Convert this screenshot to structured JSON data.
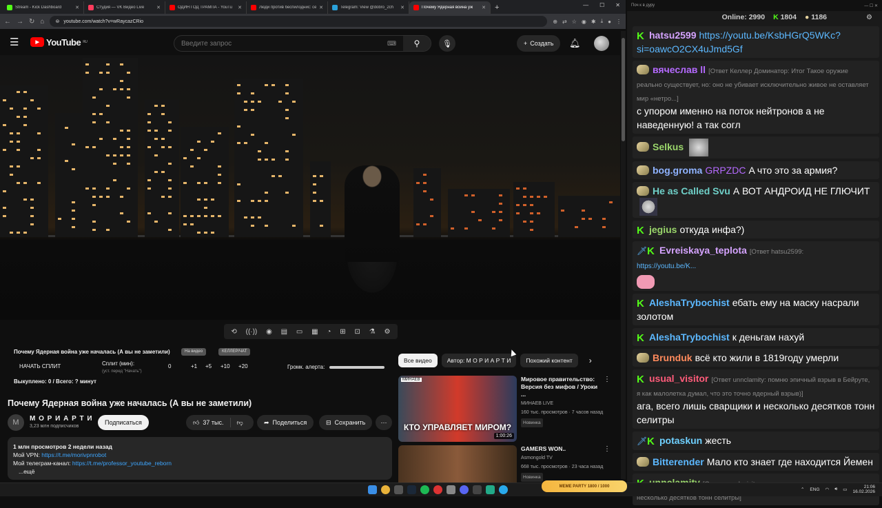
{
  "browser": {
    "tabs": [
      {
        "title": "Stream - Kick Dashboard",
        "color": "#53fc18"
      },
      {
        "title": "Студия — VK Видео Live",
        "color": "#ff3b5c"
      },
      {
        "title": "ОДИН ГОД ТРАМПА - YouTu",
        "color": "#ff0000"
      },
      {
        "title": "Люди против беспилоднис: сем",
        "color": "#ff0000"
      },
      {
        "title": "Telegram: View @dobro_2ch",
        "color": "#2aa1da"
      },
      {
        "title": "Почему Ядерная война уж",
        "color": "#ff0000"
      }
    ],
    "url": "youtube.com/watch?v=wRaycazCRio"
  },
  "youtube": {
    "logo_text": "YouTube",
    "logo_region": "RU",
    "search_placeholder": "Введите запрос",
    "create_label": "Создать",
    "video_overlay": {
      "title": "Почему Ядерная война уже началась (А вы не заметили)",
      "badge1": "На видео",
      "badge2": "КЕЛЛЕР/ЧАТ",
      "split_start": "НАЧАТЬ СПЛИТ",
      "split_label": "Сплит (мин):",
      "split_sub": "(уст. перед \"Начать\")",
      "split_values": [
        "0",
        "+1",
        "+5",
        "+10",
        "+20"
      ],
      "alert_label": "Громк. алерта:",
      "bought": "Выкуплено: 0 / Всего: ? минут"
    },
    "title": "Почему Ядерная война уже началась (А вы не заметили)",
    "channel": {
      "name": "М О Р И А Р Т И",
      "subs": "3,23 млн подписчиков",
      "subscribe": "Подписаться"
    },
    "likes": "37 тыс.",
    "share": "Поделиться",
    "save": "Сохранить",
    "description": {
      "meta": "1 млн просмотров  2 недели назад",
      "vpn_label": "Мой VPN: ",
      "vpn_link": "https://t.me/morivpnrobot",
      "tg_label": "Мой телеграм-канал: ",
      "tg_link": "https://t.me/professor_youtube_reborn",
      "more": "...ещё"
    },
    "chips": [
      "Все видео",
      "Автор: М О Р И А Р Т И",
      "Похожий контент"
    ],
    "recommendations": [
      {
        "title": "Мировое правительство: Версия без мифов / Уроки ...",
        "channel": "МИНАЕВ LIVE",
        "meta": "160 тыс. просмотров · 7 часов назад",
        "badge": "Новинка",
        "duration": "1:00:26",
        "thumb_caption": "КТО УПРАВЛЯЕТ МИРОМ?",
        "thumb_label": "МИНАЕВ"
      },
      {
        "title": "GAMERS WON..",
        "channel": "Asmongold TV",
        "meta": "668 тыс. просмотров · 23 часа назад",
        "badge": "Новинка",
        "duration": "",
        "thumb_caption": "",
        "thumb_label": ""
      }
    ]
  },
  "chat": {
    "header": "Поч к в дуру",
    "online_label": "Online:",
    "online": "2990",
    "kick_count": "1804",
    "other_count": "1186",
    "messages": [
      {
        "user": "hatsu2599",
        "color": "#d5a3ff",
        "badge": "k",
        "reply": "",
        "text": "https://youtu.be/KsbHGrQ5WKc?si=oawcO2CX4uJmd5Gf",
        "link": true
      },
      {
        "user": "вячеслав ll",
        "color": "#b56aff",
        "badge": "e",
        "reply": "[Ответ Келлер Доминатор: Итог Такое оружие реально существует, но: оно не убивает исключительно живое не оставляет мир «нетро...]",
        "text": "с упором именно на поток нейтронов а не наведенную! а так согл",
        "link": false
      },
      {
        "user": "Selkus",
        "color": "#9ad66b",
        "badge": "e",
        "reply": "",
        "text": "",
        "link": false,
        "img": "cat"
      },
      {
        "user": "bog.groma",
        "color": "#8fb3ff",
        "badge": "e",
        "reply": "",
        "text": "A что это за армия?",
        "mention": "GRPZDC",
        "link": false
      },
      {
        "user": "He as Called Svu",
        "color": "#6fd0c8",
        "badge": "e",
        "reply": "",
        "text": "А ВОТ АНДРОИД НЕ ГЛЮЧИТ",
        "link": false,
        "img": "face"
      },
      {
        "user": "jegius",
        "color": "#9ad66b",
        "badge": "k",
        "reply": "",
        "text": "откуда инфа?)",
        "link": false
      },
      {
        "user": "Evreiskaya_teplota",
        "color": "#d5a3ff",
        "badge": "sk",
        "reply": "[Ответ hatsu2599:",
        "text": "https://youtu.be/K...",
        "link": true,
        "img": "pink"
      },
      {
        "user": "AleshaTrybochist",
        "color": "#5cb8ff",
        "badge": "k",
        "reply": "",
        "text": "ебать ему на маску насрали золотом",
        "link": false
      },
      {
        "user": "AleshaTrybochist",
        "color": "#5cb8ff",
        "badge": "k",
        "reply": "",
        "text": "к деньгам нахуй",
        "link": false
      },
      {
        "user": "Brunduk",
        "color": "#ff8a5c",
        "badge": "e",
        "reply": "",
        "text": "всё кто жили в 1819году умерли",
        "link": false
      },
      {
        "user": "usual_visitor",
        "color": "#ff5c7a",
        "badge": "k",
        "reply": "[Ответ unnclamity: помню эпичный взрыв в Бейруте, я как малолетка думал, что это точно ядерный взрыв)]",
        "text": "ага, всего лишь сварщики и несколько десятков тонн селитры",
        "link": false
      },
      {
        "user": "potaskun",
        "color": "#6fd0ff",
        "badge": "sk",
        "reply": "",
        "text": "жесть",
        "link": false
      },
      {
        "user": "Bitterender",
        "color": "#5cb8ff",
        "badge": "e",
        "reply": "",
        "text": "Мало кто знает где находится Йемен",
        "link": false
      },
      {
        "user": "unnclamity",
        "color": "#9ad66b",
        "badge": "k",
        "reply": "[Ответ usual_visitor: ага, всего лишь сварщики и несколько десятков тонн селитры]",
        "text": "",
        "link": false
      }
    ]
  },
  "taskbar": {
    "meme_text": "MEME PARTY  1800 / 1000",
    "lang": "ENG",
    "time": "21:06",
    "date": "16.02.2026"
  }
}
